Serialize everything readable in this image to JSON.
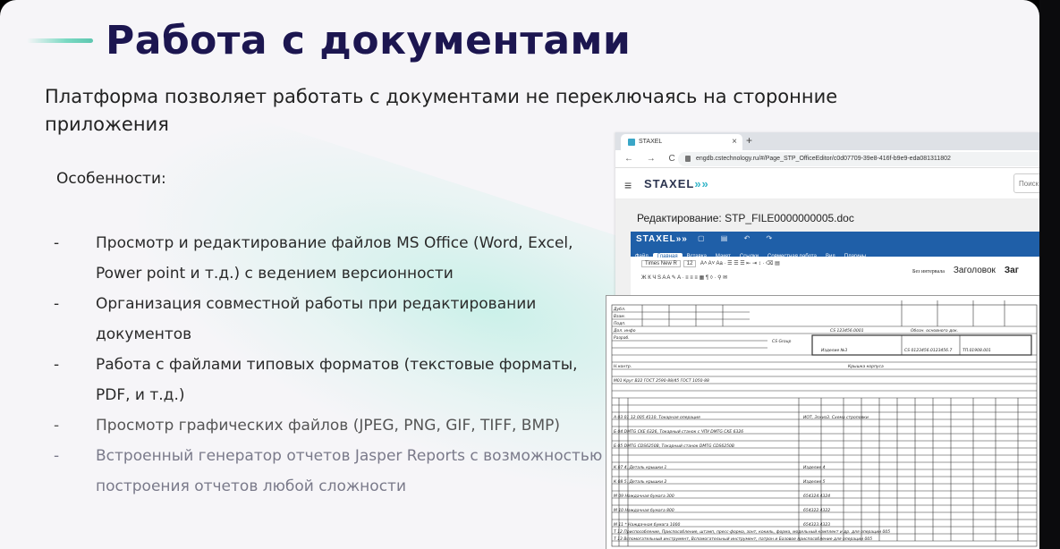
{
  "slide": {
    "title": "Работа с документами",
    "subtitle": "Платформа позволяет работать с документами не переключаясь на сторонние приложения",
    "features_heading": "Особенности:",
    "features": [
      "Просмотр и редактирование файлов MS Office (Word, Excel, Power point и т.д.) с ведением версионности",
      "Организация совместной работы при редактировании документов",
      "Работа с файлами типовых форматов (текстовые форматы, PDF, и т.д.)",
      "Просмотр графических файлов (JPEG, PNG, GIF, TIFF, BMP)",
      "Встроенный генератор отчетов Jasper Reports с возможностью построения отчетов любой сложности"
    ],
    "bullet_dash": "-"
  },
  "browser": {
    "tab_title": "STAXEL",
    "tab_close": "×",
    "tab_new": "+",
    "nav": "← → C ⌂",
    "url": "engdb.cstechnology.ru/#/Page_STP_OfficeEditor/c0d07709-39e8-416f-b9e9-eda081311802",
    "app_logo": "STAXEL",
    "app_logo_arrows": "»»",
    "search_placeholder": "Поиск",
    "edit_title": "Редактирование: STP_FILE0000000005.doc",
    "ribbon": {
      "logo": "STAXEL»»",
      "tabs": [
        "Файл",
        "Главная",
        "Вставка",
        "Макет",
        "Ссылки",
        "Совместная работа",
        "Вид",
        "Плагины"
      ],
      "active_tab": "Главная",
      "font_name": "Times New R",
      "font_size": "12",
      "styles": [
        "Без интервала",
        "Заголовок",
        "Заг"
      ]
    }
  },
  "sheet": {
    "labels": [
      "Дубл.",
      "Взам.",
      "Подп.",
      "Разраб.",
      "Н.контр.",
      "Дол. инфо",
      "CS 123456.0001",
      "Обозн. основного док.",
      "CS Group",
      "Изделие №3",
      "CS 0123456.0123456.7",
      "ТП.01908.001",
      "Крышка корпуса",
      "М01 Круг В22 ГОСТ 2590-88/45 ГОСТ 1050-88",
      "А 03 01 12 005 4110. Токарная операция",
      "ИОТ, Эскиз3. Схема строповки",
      "Б 04 DMTG CKE 6326, Токарный станок с ЧПУ DMTG CKE 6326",
      "Б 05 DMTG CDS6250B, Токарный станок DMTG CDS6250B",
      "К 07 4. Деталь крышки 1",
      "Изделие 4",
      "К 08 5. Деталь крышки 2",
      "Изделие 5",
      "М 09 Наждачная бумага 300",
      "654324.4324",
      "М 10 Наждачная бумага 800",
      "654322.4322",
      "М 11 * Наждачная бумага 1000",
      "654323.4323",
      "Т 12 Приспособление, Приспособление, штамп, пресс-форма, зонт, кокиль, форма, модельный комплект и др. для операции 005",
      "Т 13 Вспомогательный инструмент, Вспомогательный инструмент, патрон и Базовое приспособление для операции 005"
    ]
  }
}
